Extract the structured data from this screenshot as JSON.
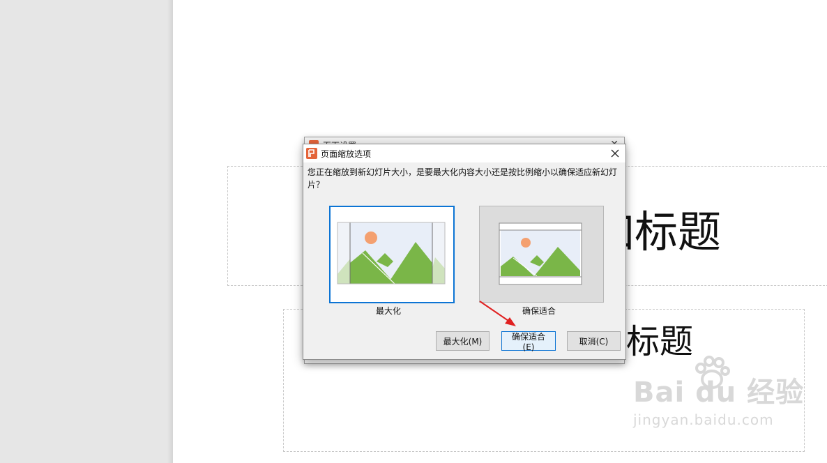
{
  "slide": {
    "title_fragment": "加标题",
    "subtitle_fragment": "标题"
  },
  "back_dialog": {
    "title": "页面设置"
  },
  "dialog": {
    "title": "页面缩放选项",
    "message": "您正在缩放到新幻灯片大小，是要最大化内容大小还是按比例缩小以确保适应新幻灯片？",
    "options": [
      {
        "label": "最大化",
        "selected": true
      },
      {
        "label": "确保适合",
        "selected": false
      }
    ],
    "buttons": {
      "maximize": "最大化(M)",
      "ensure_fit": "确保适合(E)",
      "cancel": "取消(C)"
    }
  },
  "watermark": {
    "logo": "Bai du 经验",
    "url": "jingyan.baidu.com"
  },
  "colors": {
    "accent": "#0c74d4",
    "app_icon": "#e4643a",
    "mountain": "#7ab648",
    "sun": "#f4a070",
    "sky": "#e8eef8",
    "annotation_arrow": "#e02020"
  }
}
